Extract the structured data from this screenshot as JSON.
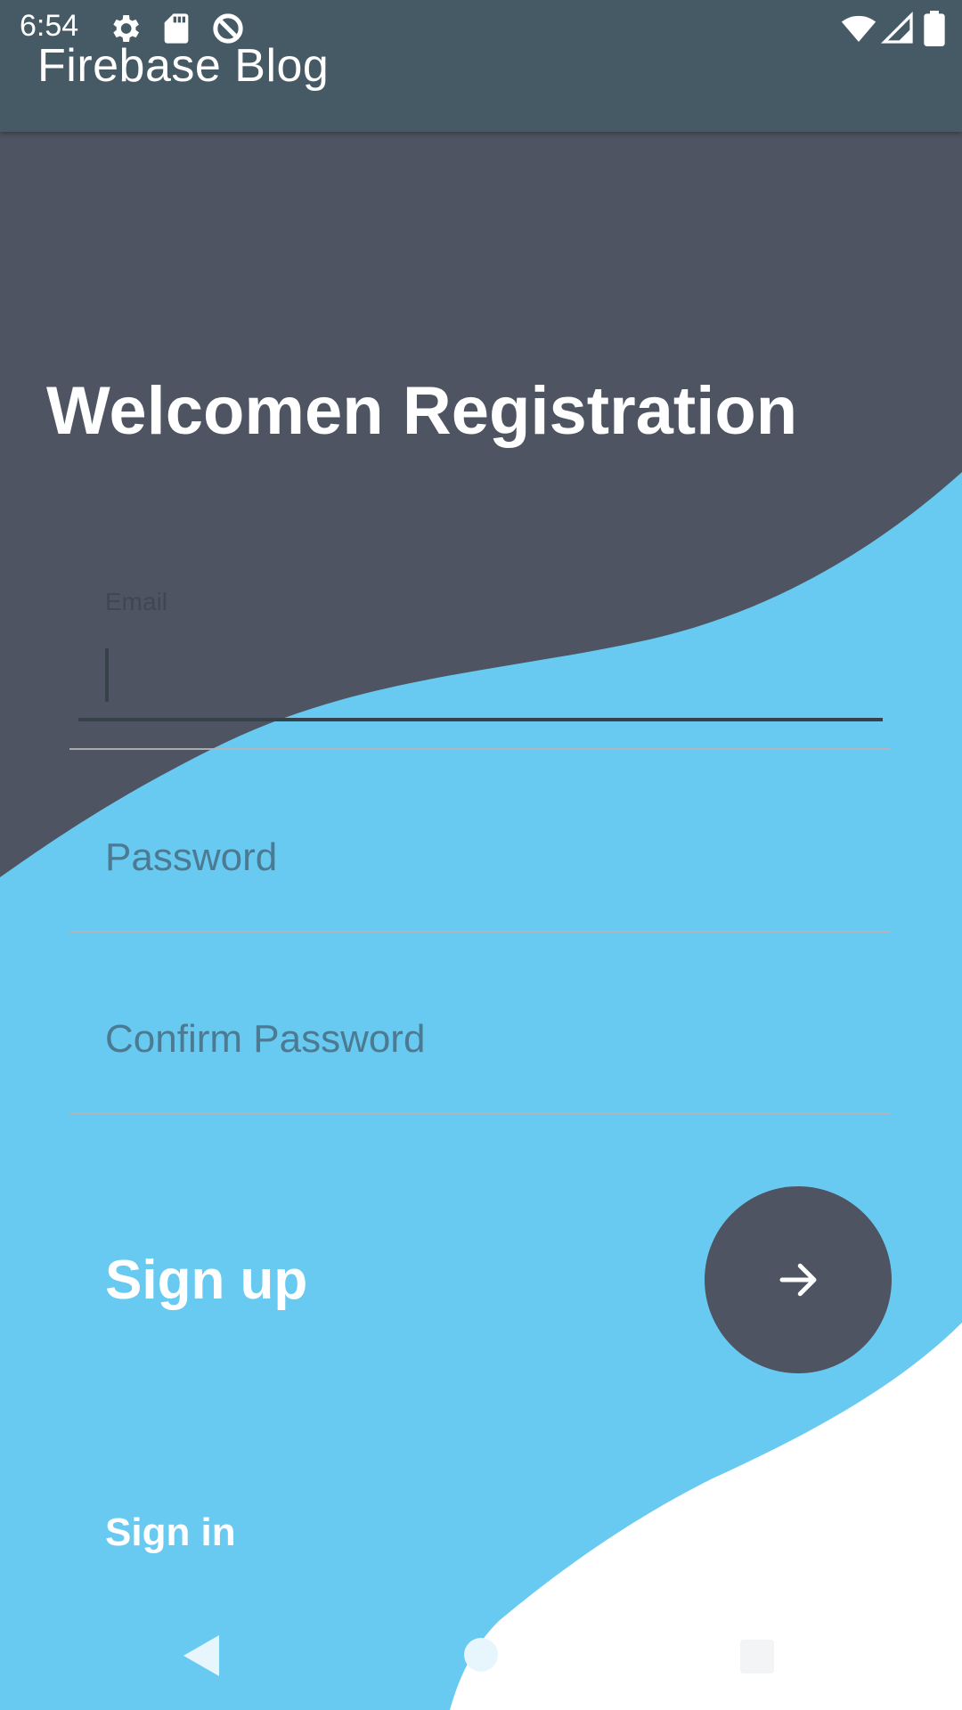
{
  "status_bar": {
    "time": "6:54",
    "left_icons": [
      "gear-icon",
      "sd-card-icon",
      "do-not-disturb-icon"
    ],
    "right_icons": [
      "wifi-icon",
      "signal-icon",
      "battery-icon"
    ]
  },
  "app_bar": {
    "title": "Firebase Blog"
  },
  "screen": {
    "heading": "Welcomen Registration",
    "email": {
      "label": "Email",
      "value": ""
    },
    "password": {
      "placeholder": "Password"
    },
    "confirm_password": {
      "placeholder": "Confirm Password"
    },
    "signup_label": "Sign up",
    "signin_link": "Sign in"
  },
  "nav_bar": {
    "buttons": [
      "back-icon",
      "home-icon",
      "recents-icon"
    ]
  },
  "colors": {
    "app_bar": "#465A66",
    "dark_wave": "#4E5461",
    "light_wave": "#68CAF0",
    "white_wave": "#FFFFFF",
    "text_on_dark": "#FFFFFF",
    "placeholder": "#4B7A92"
  }
}
